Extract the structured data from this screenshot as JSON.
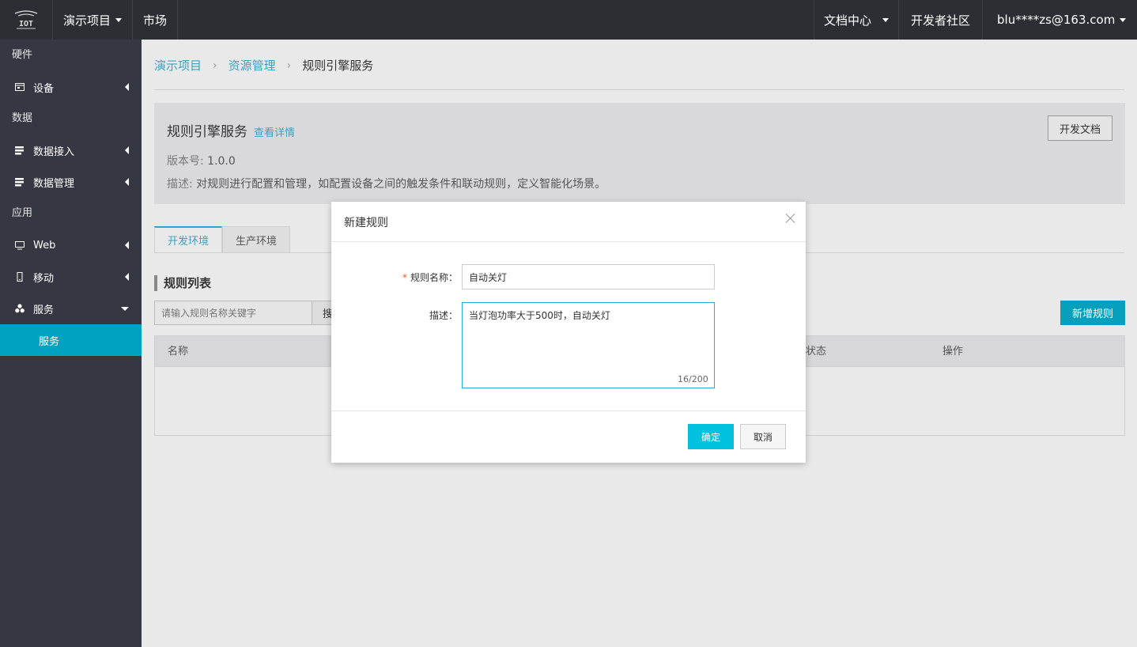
{
  "topbar": {
    "logo_icon": "iot-logo-icon",
    "project": "演示项目",
    "market": "市场",
    "docs": "文档中心",
    "community": "开发者社区",
    "user": "blu****zs@163.com"
  },
  "sidebar": {
    "groups": [
      {
        "label": "硬件"
      },
      {
        "label": "数据"
      },
      {
        "label": "应用"
      }
    ],
    "items": [
      {
        "label": "设备",
        "icon": "device-icon"
      },
      {
        "label": "数据接入",
        "icon": "data-access-icon"
      },
      {
        "label": "数据管理",
        "icon": "data-manage-icon"
      },
      {
        "label": "Web",
        "icon": "monitor-icon"
      },
      {
        "label": "移动",
        "icon": "mobile-icon"
      },
      {
        "label": "服务",
        "icon": "service-icon"
      }
    ],
    "active_sub": "服务",
    "active_color": "#00a2c1"
  },
  "breadcrumb": {
    "items": [
      "演示项目",
      "资源管理",
      "规则引擎服务"
    ],
    "sep": "›"
  },
  "info": {
    "title": "规则引擎服务",
    "detail_link": "查看详情",
    "version_label": "版本号:",
    "version": "1.0.0",
    "desc_label": "描述:",
    "desc": "对规则进行配置和管理，如配置设备之间的触发条件和联动规则，定义智能化场景。",
    "doc_button": "开发文档"
  },
  "tabs": [
    {
      "label": "开发环境",
      "active": true
    },
    {
      "label": "生产环境",
      "active": false
    }
  ],
  "list": {
    "title": "规则列表",
    "search_placeholder": "请输入规则名称关键字",
    "search_button": "搜",
    "add_button": "新增规则",
    "columns": [
      "名称",
      "状态",
      "操作"
    ]
  },
  "dialog": {
    "title": "新建规则",
    "name_label": "规则名称：",
    "name_value": "自动关灯",
    "desc_label": "描述：",
    "desc_value": "当灯泡功率大于500时，自动关灯",
    "counter": "16/200",
    "ok": "确定",
    "cancel": "取消"
  }
}
